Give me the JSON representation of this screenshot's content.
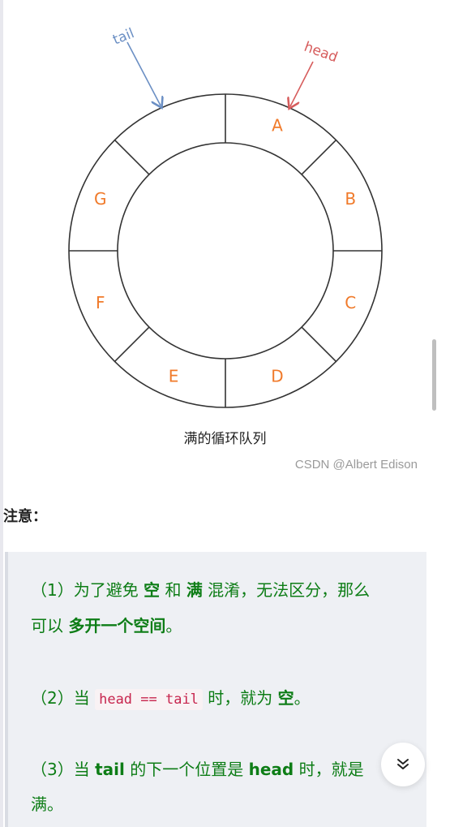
{
  "diagram": {
    "segments": [
      "A",
      "B",
      "C",
      "D",
      "E",
      "F",
      "G",
      ""
    ],
    "pointers": {
      "tail": "tail",
      "head": "head"
    },
    "colors": {
      "segment_label": "#f07a2a",
      "tail": "#6b8fc4",
      "head": "#d65c5c"
    }
  },
  "caption": "满的循环队列",
  "watermark": "CSDN @Albert Edison",
  "note": {
    "title": "注意：",
    "line1": {
      "pre": "（1）为了避免 ",
      "b1": "空",
      "mid1": " 和 ",
      "b2": "满",
      "post": " 混淆，无法区分，那么"
    },
    "line2": {
      "pre": "可以 ",
      "b": "多开一个空间",
      "post": "。"
    },
    "line3": {
      "pre": "（2）当 ",
      "code": "head == tail",
      "mid": " 时，就为 ",
      "b": "空",
      "post": "。"
    },
    "line4": {
      "pre": "（3）当 ",
      "b1": "tail",
      "mid1": " 的下一个位置是 ",
      "b2": "head",
      "post": " 时，就是"
    },
    "line5": {
      "text": "满。"
    }
  },
  "fab": {
    "icon": "double-chevron-down-icon",
    "glyph": "⌄⌄"
  }
}
